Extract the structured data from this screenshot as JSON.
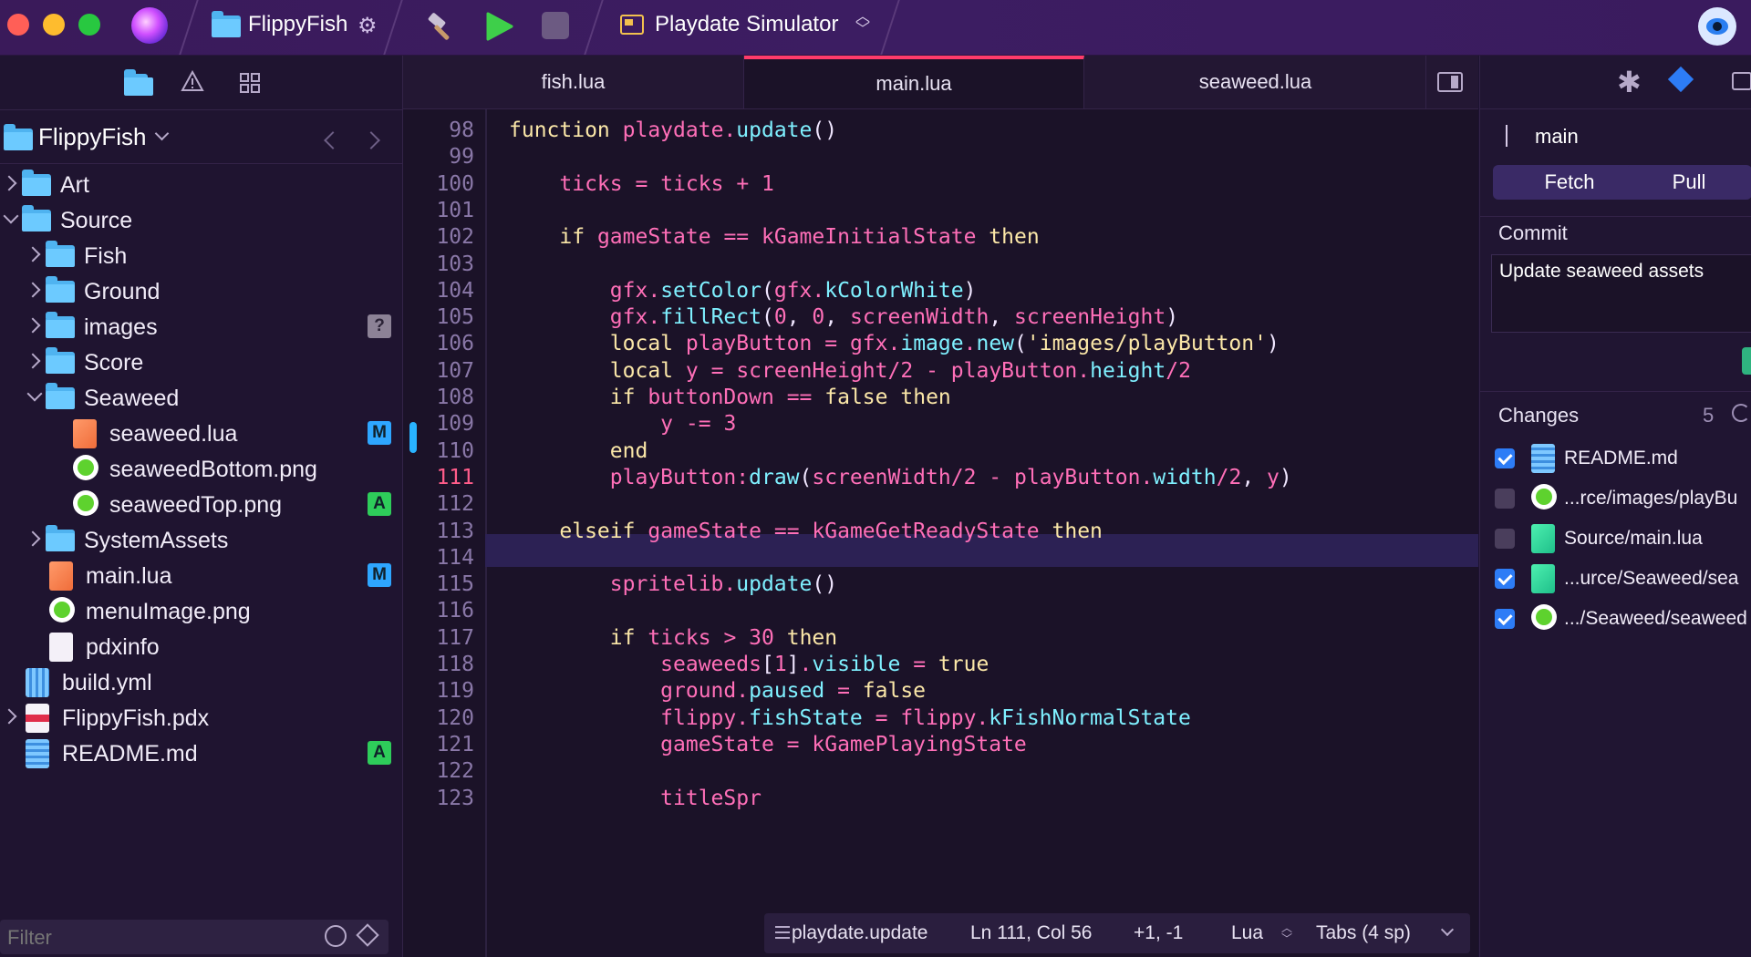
{
  "toolbar": {
    "project_name": "FlippyFish",
    "scheme_name": "Playdate Simulator"
  },
  "sidebar": {
    "root_label": "FlippyFish",
    "filter_placeholder": "Filter",
    "tree": [
      {
        "label": "Art",
        "kind": "folder",
        "level": 0,
        "state": "collapsed"
      },
      {
        "label": "Source",
        "kind": "folder",
        "level": 0,
        "state": "expanded"
      },
      {
        "label": "Fish",
        "kind": "folder",
        "level": 1,
        "state": "collapsed"
      },
      {
        "label": "Ground",
        "kind": "folder",
        "level": 1,
        "state": "collapsed"
      },
      {
        "label": "images",
        "kind": "folder",
        "level": 1,
        "state": "collapsed",
        "badge": "?"
      },
      {
        "label": "Score",
        "kind": "folder",
        "level": 1,
        "state": "collapsed"
      },
      {
        "label": "Seaweed",
        "kind": "folder",
        "level": 1,
        "state": "expanded"
      },
      {
        "label": "seaweed.lua",
        "kind": "lua",
        "level": 2,
        "badge": "M"
      },
      {
        "label": "seaweedBottom.png",
        "kind": "png",
        "level": 2
      },
      {
        "label": "seaweedTop.png",
        "kind": "png",
        "level": 2,
        "badge": "A"
      },
      {
        "label": "SystemAssets",
        "kind": "folder",
        "level": 1,
        "state": "collapsed"
      },
      {
        "label": "main.lua",
        "kind": "lua",
        "level": 1,
        "badge": "M"
      },
      {
        "label": "menuImage.png",
        "kind": "png",
        "level": 1
      },
      {
        "label": "pdxinfo",
        "kind": "blank",
        "level": 1
      },
      {
        "label": "build.yml",
        "kind": "yml",
        "level": 0
      },
      {
        "label": "FlippyFish.pdx",
        "kind": "pdx",
        "level": 0,
        "state": "collapsed"
      },
      {
        "label": "README.md",
        "kind": "md",
        "level": 0,
        "badge": "A"
      }
    ]
  },
  "editor": {
    "tabs": [
      "fish.lua",
      "main.lua",
      "seaweed.lua"
    ],
    "active_tab": "main.lua",
    "current_line": "111",
    "lines": [
      {
        "n": "98",
        "text": "function playdate.update()"
      },
      {
        "n": "99",
        "text": ""
      },
      {
        "n": "100",
        "text": "    ticks = ticks + 1"
      },
      {
        "n": "101",
        "text": ""
      },
      {
        "n": "102",
        "text": "    if gameState == kGameInitialState then"
      },
      {
        "n": "103",
        "text": ""
      },
      {
        "n": "104",
        "text": "        gfx.setColor(gfx.kColorWhite)"
      },
      {
        "n": "105",
        "text": "        gfx.fillRect(0, 0, screenWidth, screenHeight)"
      },
      {
        "n": "106",
        "text": "        local playButton = gfx.image.new('images/playButton')"
      },
      {
        "n": "107",
        "text": "        local y = screenHeight/2 - playButton.height/2"
      },
      {
        "n": "108",
        "text": "        if buttonDown == false then"
      },
      {
        "n": "109",
        "text": "            y -= 3"
      },
      {
        "n": "110",
        "text": "        end"
      },
      {
        "n": "111",
        "text": "        playButton:draw(screenWidth/2 - playButton.width/2, y)"
      },
      {
        "n": "112",
        "text": ""
      },
      {
        "n": "113",
        "text": "    elseif gameState == kGameGetReadyState then"
      },
      {
        "n": "114",
        "text": ""
      },
      {
        "n": "115",
        "text": "        spritelib.update()"
      },
      {
        "n": "116",
        "text": ""
      },
      {
        "n": "117",
        "text": "        if ticks > 30 then"
      },
      {
        "n": "118",
        "text": "            seaweeds[1].visible = true"
      },
      {
        "n": "119",
        "text": "            ground.paused = false"
      },
      {
        "n": "120",
        "text": "            flippy.fishState = flippy.kFishNormalState"
      },
      {
        "n": "121",
        "text": "            gameState = kGamePlayingState"
      },
      {
        "n": "122",
        "text": ""
      },
      {
        "n": "123",
        "text": "            titleSpr"
      }
    ],
    "status": {
      "symbol": "playdate.update",
      "position": "Ln 111, Col 56",
      "diff": "+1, -1",
      "language": "Lua",
      "indent": "Tabs (4 sp)"
    }
  },
  "inspector": {
    "branch": "main",
    "fetch_label": "Fetch",
    "pull_label": "Pull",
    "commit_heading": "Commit",
    "commit_message": "Update seaweed assets",
    "changes_heading": "Changes",
    "changes_count": "5",
    "changes": [
      {
        "label": "README.md",
        "checked": true,
        "kind": "md"
      },
      {
        "label": "...rce/images/playBu",
        "checked": false,
        "kind": "png"
      },
      {
        "label": "Source/main.lua",
        "checked": false,
        "kind": "lua"
      },
      {
        "label": "...urce/Seaweed/sea",
        "checked": true,
        "kind": "lua"
      },
      {
        "label": ".../Seaweed/seaweed",
        "checked": true,
        "kind": "png"
      }
    ]
  },
  "colors": {
    "toolbar_bg": "#3c1d62",
    "editor_bg": "#1b1228",
    "active_tab_accent": "#ff3b6b",
    "folder": "#4fb3f0",
    "badge_m": "#2ea6ff",
    "badge_a": "#2ecc5a"
  }
}
